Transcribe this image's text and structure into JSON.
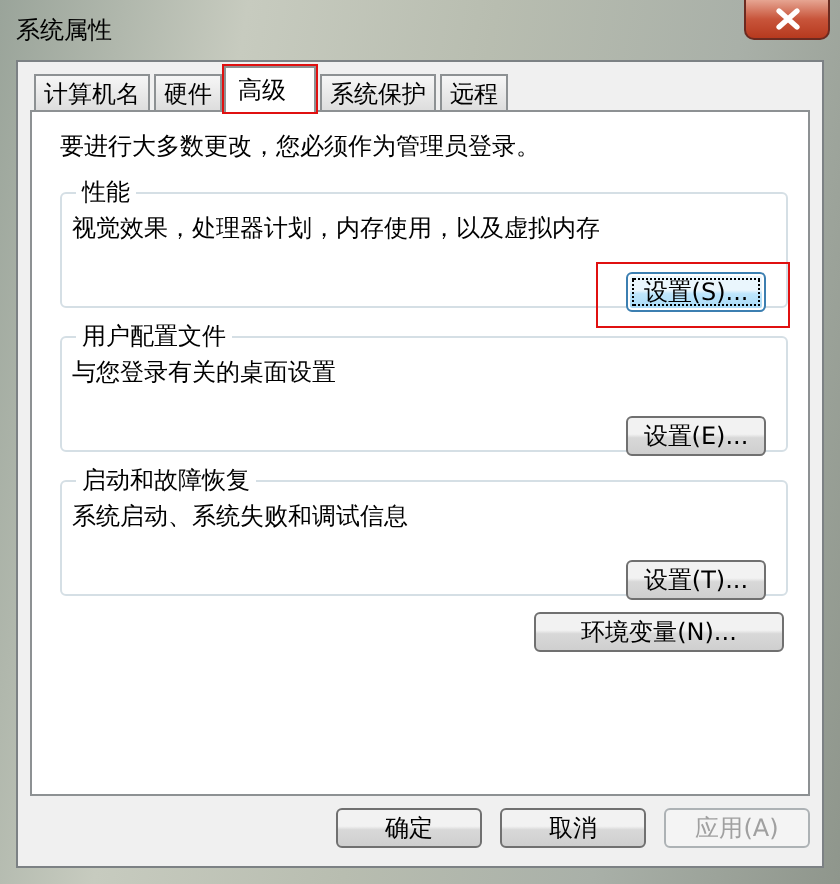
{
  "window": {
    "title": "系统属性"
  },
  "tabs": [
    {
      "label": "计算机名",
      "selected": false,
      "highlighted": false
    },
    {
      "label": "硬件",
      "selected": false,
      "highlighted": false
    },
    {
      "label": "高级",
      "selected": true,
      "highlighted": true
    },
    {
      "label": "系统保护",
      "selected": false,
      "highlighted": false
    },
    {
      "label": "远程",
      "selected": false,
      "highlighted": false
    }
  ],
  "notice": "要进行大多数更改，您必须作为管理员登录。",
  "groups": [
    {
      "title": "性能",
      "description": "视觉效果，处理器计划，内存使用，以及虚拟内存",
      "button": {
        "label": "设置(S)...",
        "focused": true,
        "highlighted": true
      }
    },
    {
      "title": "用户配置文件",
      "description": "与您登录有关的桌面设置",
      "button": {
        "label": "设置(E)...",
        "focused": false,
        "highlighted": false
      }
    },
    {
      "title": "启动和故障恢复",
      "description": "系统启动、系统失败和调试信息",
      "button": {
        "label": "设置(T)...",
        "focused": false,
        "highlighted": false
      }
    }
  ],
  "env_button": "环境变量(N)...",
  "footer_buttons": [
    {
      "label": "确定",
      "disabled": false
    },
    {
      "label": "取消",
      "disabled": false
    },
    {
      "label": "应用(A)",
      "disabled": true
    }
  ]
}
